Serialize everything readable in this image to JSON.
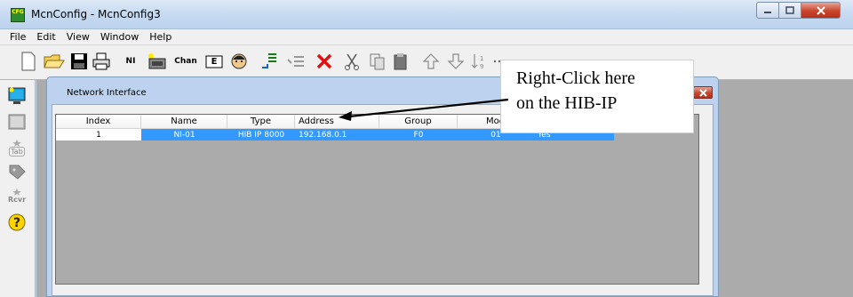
{
  "window": {
    "title": "McnConfig - McnConfig3",
    "app_icon_text": "CFG"
  },
  "menu": [
    "File",
    "Edit",
    "View",
    "Window",
    "Help"
  ],
  "toolbar": {
    "ni_label": "NI",
    "chan_label": "Chan",
    "e_label": "E"
  },
  "left_toolbar": {
    "tab_label": "Tab",
    "rcvr_label": "Rcvr"
  },
  "child_window": {
    "title": "Network Interface"
  },
  "table": {
    "columns": [
      "Index",
      "Name",
      "Type",
      "Address",
      "Group",
      "Mod",
      ""
    ],
    "rows": [
      {
        "index": "1",
        "name": "NI-01",
        "type": "HIB IP 8000",
        "address": "192.168.0.1",
        "group": "F0",
        "mod": "01",
        "extra": "Yes"
      }
    ]
  },
  "annotation": {
    "line1": "Right-Click here",
    "line2": "on the HIB-IP"
  },
  "colors": {
    "selection": "#3399ff",
    "mdi_background": "#ababab",
    "title_gradient": "#c8dbf1"
  }
}
